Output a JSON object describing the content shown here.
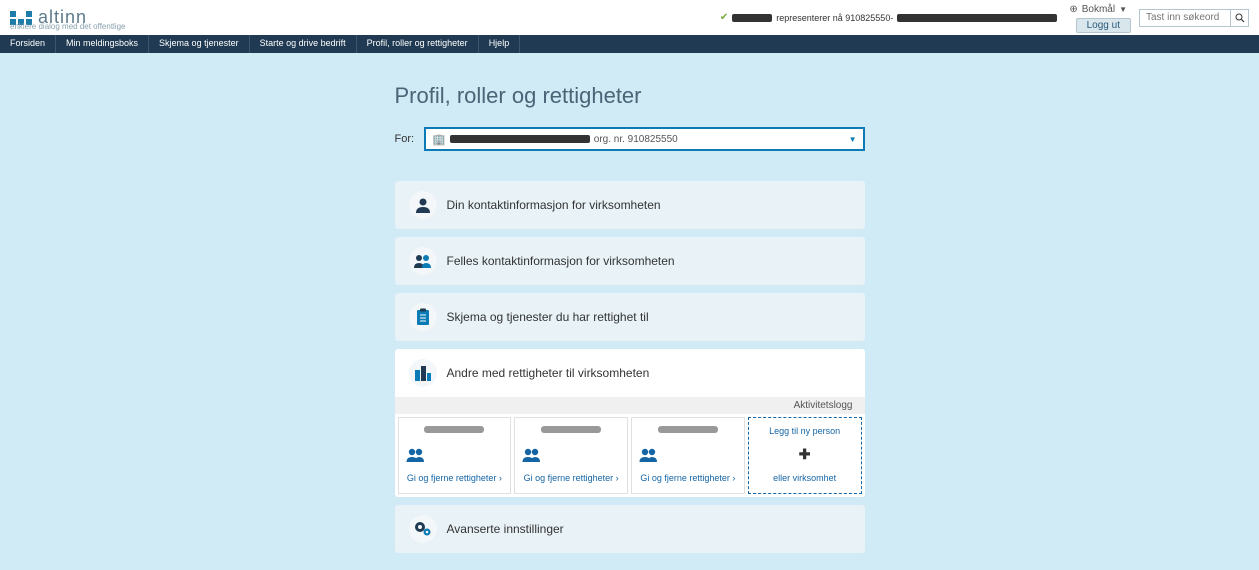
{
  "header": {
    "logo_text": "altinn",
    "logo_sub": "enklere dialog med det offentlige",
    "represents": "representerer nå 910825550-",
    "language": "Bokmål",
    "logout": "Logg ut",
    "search_placeholder": "Tast inn søkeord"
  },
  "nav": {
    "forsiden": "Forsiden",
    "meldingsboks": "Min meldingsboks",
    "skjema": "Skjema og tjenester",
    "starte": "Starte og drive bedrift",
    "profil": "Profil, roller og rettigheter",
    "hjelp": "Hjelp"
  },
  "page": {
    "title": "Profil, roller og rettigheter",
    "for_label": "For:",
    "orgnr": "org. nr. 910825550"
  },
  "panels": {
    "kontakt": "Din kontaktinformasjon for virksomheten",
    "felles": "Felles kontaktinformasjon for virksomheten",
    "skjema": "Skjema og tjenester du har rettighet til",
    "andre": "Andre med rettigheter til virksomheten",
    "avanserte": "Avanserte innstillinger"
  },
  "sub": {
    "aktivitetslogg": "Aktivitetslogg",
    "card_action": "Gi og fjerne rettigheter ›",
    "add_top": "Legg til ny person",
    "add_bot": "eller virksomhet"
  }
}
